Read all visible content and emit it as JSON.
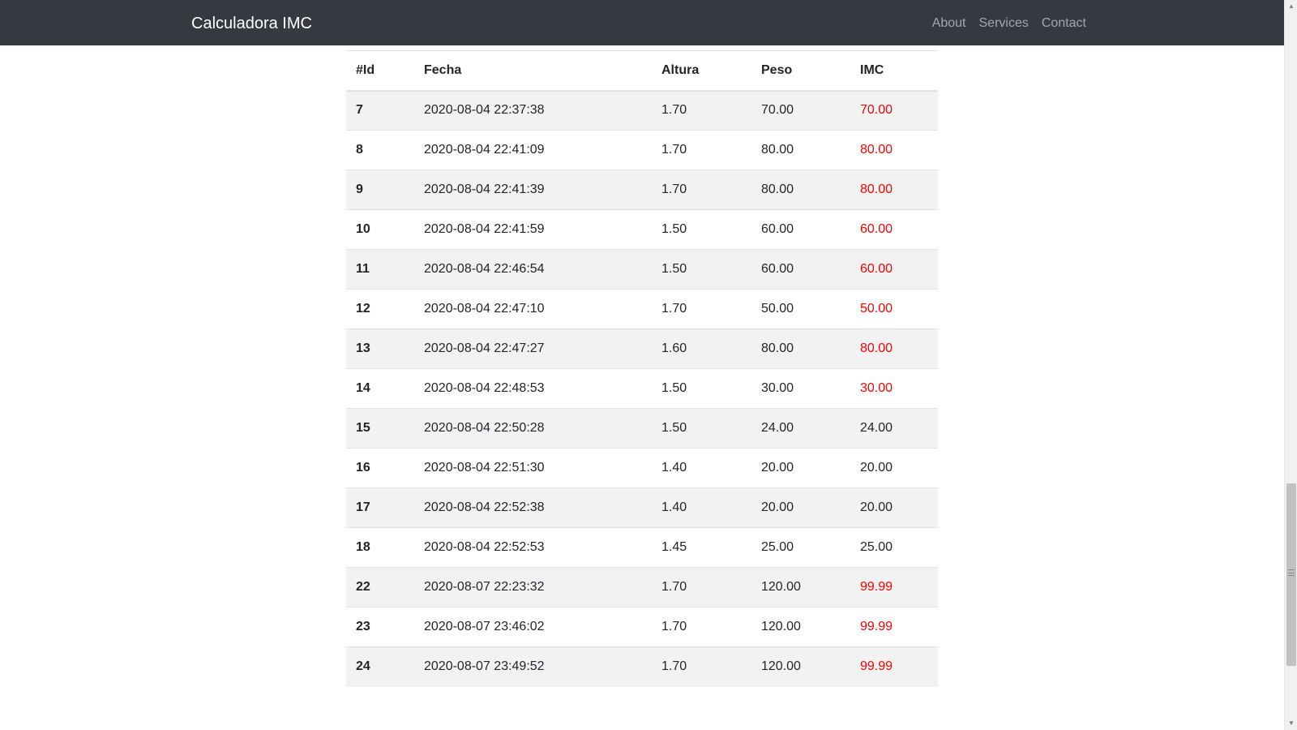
{
  "navbar": {
    "brand": "Calculadora IMC",
    "links": [
      "About",
      "Services",
      "Contact"
    ]
  },
  "table": {
    "headers": [
      "#Id",
      "Fecha",
      "Altura",
      "Peso",
      "IMC"
    ],
    "rows": [
      {
        "id": "7",
        "fecha": "2020-08-04 22:37:38",
        "altura": "1.70",
        "peso": "70.00",
        "imc": "70.00",
        "imc_flag": "high"
      },
      {
        "id": "8",
        "fecha": "2020-08-04 22:41:09",
        "altura": "1.70",
        "peso": "80.00",
        "imc": "80.00",
        "imc_flag": "high"
      },
      {
        "id": "9",
        "fecha": "2020-08-04 22:41:39",
        "altura": "1.70",
        "peso": "80.00",
        "imc": "80.00",
        "imc_flag": "high"
      },
      {
        "id": "10",
        "fecha": "2020-08-04 22:41:59",
        "altura": "1.50",
        "peso": "60.00",
        "imc": "60.00",
        "imc_flag": "high"
      },
      {
        "id": "11",
        "fecha": "2020-08-04 22:46:54",
        "altura": "1.50",
        "peso": "60.00",
        "imc": "60.00",
        "imc_flag": "high"
      },
      {
        "id": "12",
        "fecha": "2020-08-04 22:47:10",
        "altura": "1.70",
        "peso": "50.00",
        "imc": "50.00",
        "imc_flag": "high"
      },
      {
        "id": "13",
        "fecha": "2020-08-04 22:47:27",
        "altura": "1.60",
        "peso": "80.00",
        "imc": "80.00",
        "imc_flag": "high"
      },
      {
        "id": "14",
        "fecha": "2020-08-04 22:48:53",
        "altura": "1.50",
        "peso": "30.00",
        "imc": "30.00",
        "imc_flag": "high"
      },
      {
        "id": "15",
        "fecha": "2020-08-04 22:50:28",
        "altura": "1.50",
        "peso": "24.00",
        "imc": "24.00",
        "imc_flag": "normal"
      },
      {
        "id": "16",
        "fecha": "2020-08-04 22:51:30",
        "altura": "1.40",
        "peso": "20.00",
        "imc": "20.00",
        "imc_flag": "normal"
      },
      {
        "id": "17",
        "fecha": "2020-08-04 22:52:38",
        "altura": "1.40",
        "peso": "20.00",
        "imc": "20.00",
        "imc_flag": "normal"
      },
      {
        "id": "18",
        "fecha": "2020-08-04 22:52:53",
        "altura": "1.45",
        "peso": "25.00",
        "imc": "25.00",
        "imc_flag": "normal"
      },
      {
        "id": "22",
        "fecha": "2020-08-07 22:23:32",
        "altura": "1.70",
        "peso": "120.00",
        "imc": "99.99",
        "imc_flag": "high"
      },
      {
        "id": "23",
        "fecha": "2020-08-07 23:46:02",
        "altura": "1.70",
        "peso": "120.00",
        "imc": "99.99",
        "imc_flag": "high"
      },
      {
        "id": "24",
        "fecha": "2020-08-07 23:49:52",
        "altura": "1.70",
        "peso": "120.00",
        "imc": "99.99",
        "imc_flag": "high"
      }
    ]
  },
  "colors": {
    "navbar_bg": "#343a40",
    "imc_high": "#ff0000",
    "row_stripe": "#f2f2f2"
  }
}
